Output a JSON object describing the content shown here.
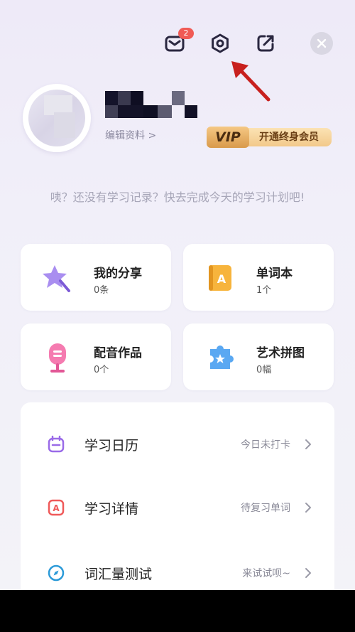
{
  "header": {
    "mail_badge_count": "2",
    "icons": [
      "mail-icon",
      "settings-icon",
      "share-icon",
      "close-icon"
    ]
  },
  "profile": {
    "edit_label": "编辑资料 >",
    "vip_tag": "VIP",
    "vip_label": "开通终身会员"
  },
  "hint": "咦？还没有学习记录？快去完成今天的学习计划吧!",
  "cards": [
    {
      "title": "我的分享",
      "sub": "0条",
      "icon": "star-wand-icon"
    },
    {
      "title": "单词本",
      "sub": "1个",
      "icon": "word-book-icon"
    },
    {
      "title": "配音作品",
      "sub": "0个",
      "icon": "microphone-icon"
    },
    {
      "title": "艺术拼图",
      "sub": "0幅",
      "icon": "puzzle-icon"
    }
  ],
  "list": [
    {
      "label": "学习日历",
      "value": "今日未打卡",
      "icon": "calendar-icon"
    },
    {
      "label": "学习详情",
      "value": "待复习单词",
      "icon": "study-detail-icon"
    },
    {
      "label": "词汇量测试",
      "value": "来试试呗~",
      "icon": "compass-icon"
    }
  ],
  "colors": {
    "accent_purple": "#8b6be0",
    "badge_red": "#f05a55",
    "vip_gold": "#e0a453",
    "annotation_arrow": "#c8201e"
  }
}
